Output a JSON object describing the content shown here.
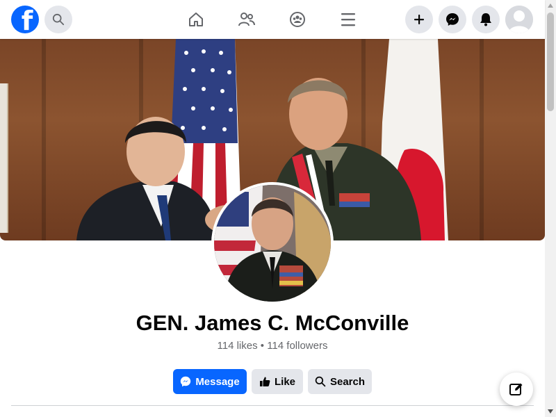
{
  "topbar": {
    "logo_letter": "f",
    "icons": [
      "facebook-logo-icon",
      "search-icon",
      "home-icon",
      "friends-icon",
      "groups-icon",
      "menu-icon",
      "plus-icon",
      "messenger-icon",
      "bell-icon",
      "avatar-icon"
    ]
  },
  "cover": {
    "image_alt": "Two men shaking hands in front of U.S. and Japanese flags"
  },
  "profile": {
    "name": "GEN. James C. McConville",
    "stats": "114 likes • 114 followers",
    "image_alt": "Portrait of a general in dress uniform"
  },
  "actions": {
    "message_label": "Message",
    "like_label": "Like",
    "search_label": "Search"
  },
  "colors": {
    "accent": "#0866ff",
    "button_gray": "#e4e6eb",
    "text_primary": "#050505",
    "text_secondary": "#65676b"
  }
}
